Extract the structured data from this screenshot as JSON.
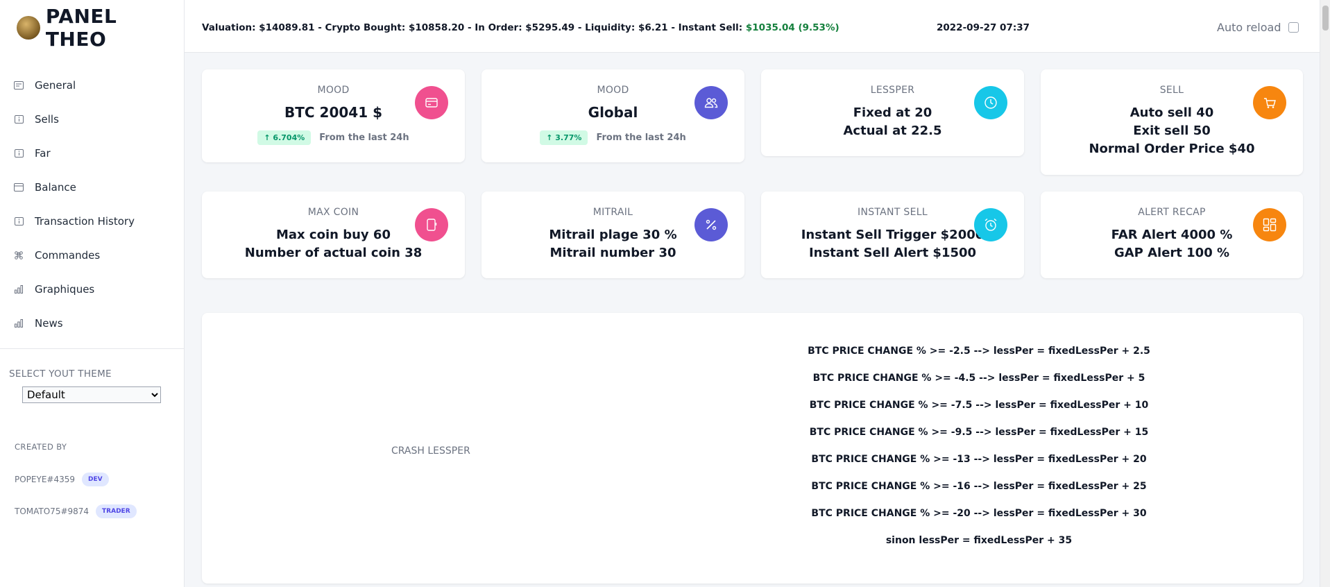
{
  "sidebar": {
    "brand_title": "PANEL THEO",
    "nav": [
      {
        "label": "General",
        "icon": "receipt-icon"
      },
      {
        "label": "Sells",
        "icon": "info-icon"
      },
      {
        "label": "Far",
        "icon": "info-icon"
      },
      {
        "label": "Balance",
        "icon": "credit-card-icon"
      },
      {
        "label": "Transaction History",
        "icon": "info-icon"
      },
      {
        "label": "Commandes",
        "icon": "command-icon"
      },
      {
        "label": "Graphiques",
        "icon": "bar-chart-icon"
      },
      {
        "label": "News",
        "icon": "bar-chart-icon"
      }
    ],
    "theme_label": "SELECT YOUT THEME",
    "theme_value": "Default",
    "created_by": "CREATED BY",
    "members": [
      {
        "name": "POPEYE#4359",
        "badge": "DEV"
      },
      {
        "name": "TOMATO75#9874",
        "badge": "TRADER"
      }
    ]
  },
  "topbar": {
    "stats_prefix": "Valuation: $14089.81 - Crypto Bought: $10858.20 - In Order: $5295.49 - Liquidity: $6.21 - Instant Sell: ",
    "instant_sell_value": "$1035.04 (9.53%)",
    "datetime": "2022-09-27 07:37",
    "auto_reload": "Auto reload"
  },
  "cards": {
    "mood_btc": {
      "label": "MOOD",
      "value": "BTC 20041 $",
      "trend": "↑ 6.704%",
      "trend_text": "From the last 24h",
      "icon": "credit-card-icon",
      "color": "#f0508f"
    },
    "mood_global": {
      "label": "MOOD",
      "value": "Global",
      "trend": "↑ 3.77%",
      "trend_text": "From the last 24h",
      "icon": "users-icon",
      "color": "#5b5bd6"
    },
    "lessper": {
      "label": "LESSPER",
      "lines": [
        "Fixed at 20",
        "Actual at 22.5"
      ],
      "icon": "clock-icon",
      "color": "#17c7e8"
    },
    "sell": {
      "label": "SELL",
      "lines": [
        "Auto sell 40",
        "Exit sell 50",
        "Normal Order Price $40"
      ],
      "icon": "cart-icon",
      "color": "#f7860f"
    },
    "max_coin": {
      "label": "MAX COIN",
      "lines": [
        "Max coin buy 60",
        "Number of actual coin 38"
      ],
      "icon": "tablet-icon",
      "color": "#f0508f"
    },
    "mitrail": {
      "label": "MITRAIL",
      "lines": [
        "Mitrail plage 30 %",
        "Mitrail number 30"
      ],
      "icon": "percent-icon",
      "color": "#5b5bd6"
    },
    "instant_sell": {
      "label": "INSTANT SELL",
      "lines": [
        "Instant Sell Trigger $2000",
        "Instant Sell Alert $1500"
      ],
      "icon": "alarm-icon",
      "color": "#17c7e8"
    },
    "alert_recap": {
      "label": "ALERT RECAP",
      "lines": [
        "FAR Alert 4000 %",
        "GAP Alert 100 %"
      ],
      "icon": "dashboard-icon",
      "color": "#f7860f"
    }
  },
  "crash": {
    "title": "CRASH LESSPER",
    "rules": [
      "BTC PRICE CHANGE % >= -2.5 --> lessPer = fixedLessPer + 2.5",
      "BTC PRICE CHANGE % >= -4.5 --> lessPer = fixedLessPer + 5",
      "BTC PRICE CHANGE % >= -7.5 --> lessPer = fixedLessPer + 10",
      "BTC PRICE CHANGE % >= -9.5 --> lessPer = fixedLessPer + 15",
      "BTC PRICE CHANGE % >= -13 --> lessPer = fixedLessPer + 20",
      "BTC PRICE CHANGE % >= -16 --> lessPer = fixedLessPer + 25",
      "BTC PRICE CHANGE % >= -20 --> lessPer = fixedLessPer + 30",
      "sinon lessPer = fixedLessPer + 35"
    ]
  }
}
